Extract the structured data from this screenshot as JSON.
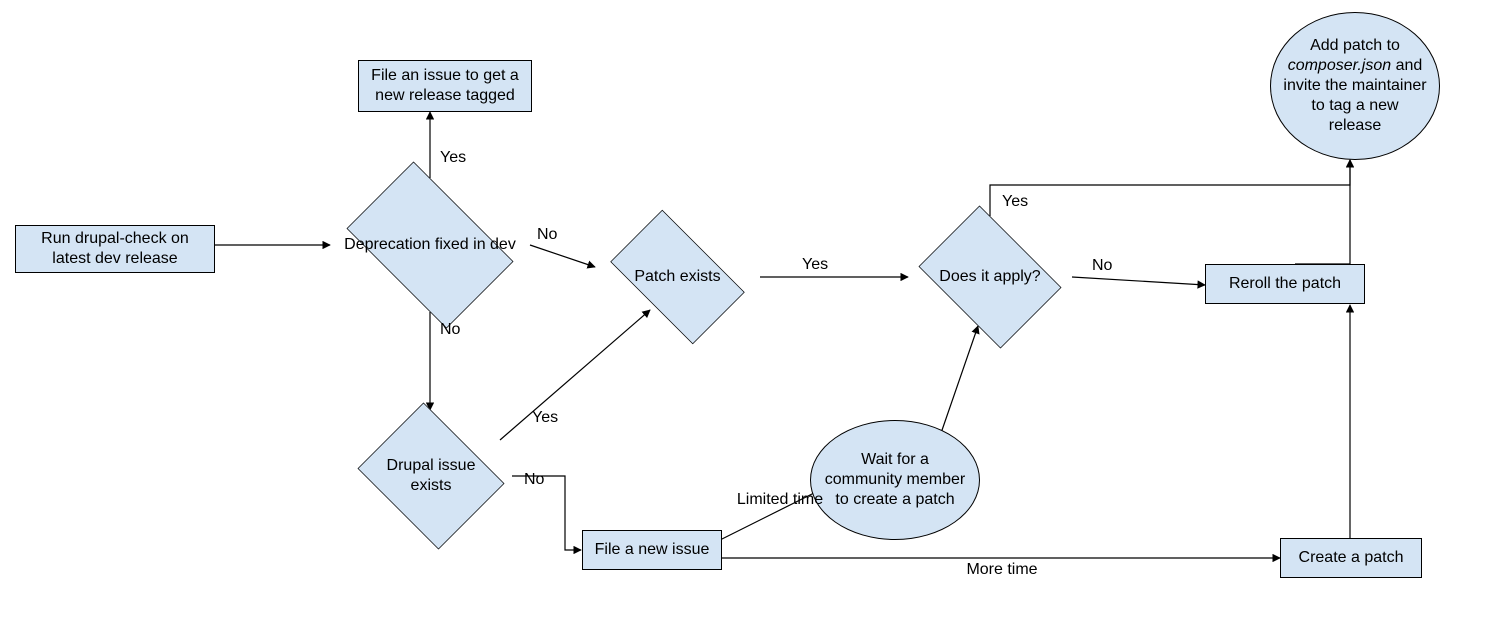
{
  "nodes": {
    "run_check": "Run drupal-check on latest dev release",
    "file_issue_release": "File an issue to get a new release tagged",
    "deprecation_fixed": "Deprecation fixed in dev",
    "patch_exists": "Patch exists",
    "does_apply": "Does it apply?",
    "reroll_patch": "Reroll the patch",
    "add_patch_prefix": "Add patch to ",
    "add_patch_italic": "composer.json",
    "add_patch_suffix": " and invite the maintainer to tag a new release",
    "drupal_issue_exists": "Drupal issue exists",
    "file_new_issue": "File a new issue",
    "wait_community": "Wait for a community member to create a patch",
    "create_patch": "Create a patch"
  },
  "edges": {
    "yes": "Yes",
    "no": "No",
    "limited_time": "Limited time",
    "more_time": "More time"
  }
}
